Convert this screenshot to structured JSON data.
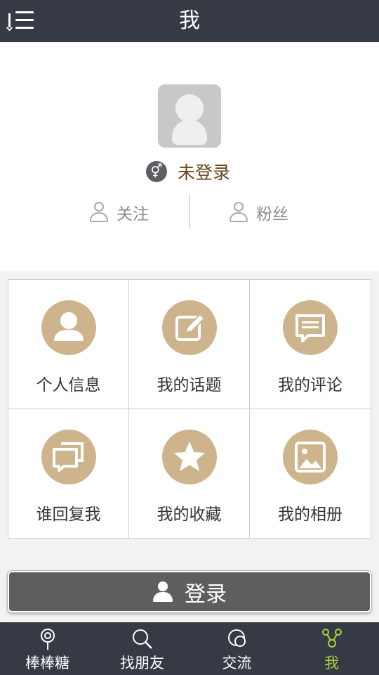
{
  "header": {
    "title": "我",
    "menu_icon": "menu-list-icon"
  },
  "profile": {
    "status": "未登录",
    "gender_icon": "gender-icon",
    "gender_symbol": "⚥",
    "follow_label": "关注",
    "fans_label": "粉丝"
  },
  "menu": {
    "items": [
      {
        "label": "个人信息",
        "icon": "person-icon"
      },
      {
        "label": "我的话题",
        "icon": "edit-icon"
      },
      {
        "label": "我的评论",
        "icon": "comment-icon"
      },
      {
        "label": "谁回复我",
        "icon": "replies-icon"
      },
      {
        "label": "我的收藏",
        "icon": "star-icon"
      },
      {
        "label": "我的相册",
        "icon": "photo-icon"
      }
    ],
    "accent_color": "#cdb48d"
  },
  "login_button": {
    "label": "登录"
  },
  "tabbar": {
    "items": [
      {
        "label": "棒棒糖",
        "icon": "lollipop-icon"
      },
      {
        "label": "找朋友",
        "icon": "search-icon"
      },
      {
        "label": "交流",
        "icon": "chat-icon"
      },
      {
        "label": "我",
        "icon": "me-icon",
        "active": true
      }
    ],
    "active_color": "#a6d63a"
  }
}
